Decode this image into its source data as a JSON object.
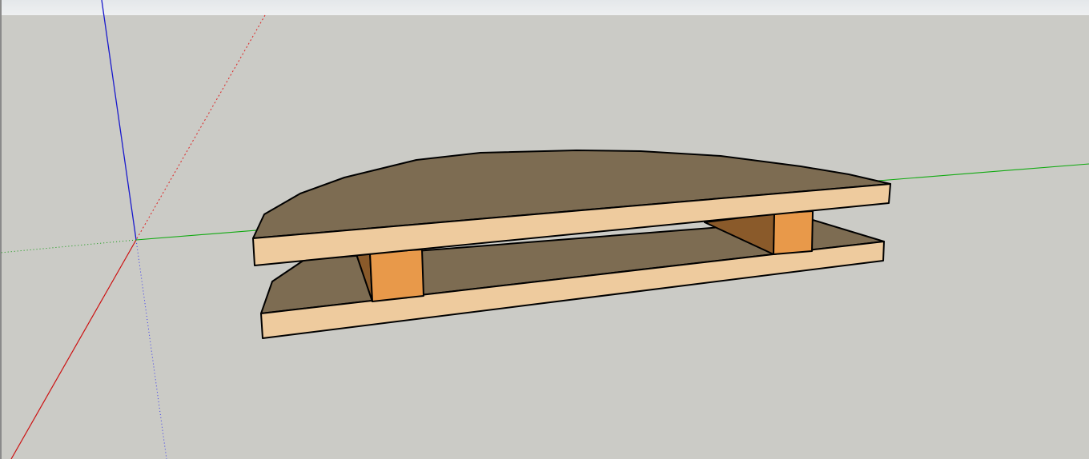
{
  "viewport": {
    "sky_color": "#e9ecee",
    "ground_color": "#cbcbc6",
    "axis_colors": {
      "red": "#cc0000",
      "green": "#00aa00",
      "blue": "#0000cc"
    },
    "model_colors": {
      "top_face": "#7d6c52",
      "wood_edge": "#eecb9e",
      "leg_front": "#e8994a",
      "leg_side": "#8a5a2a"
    }
  }
}
